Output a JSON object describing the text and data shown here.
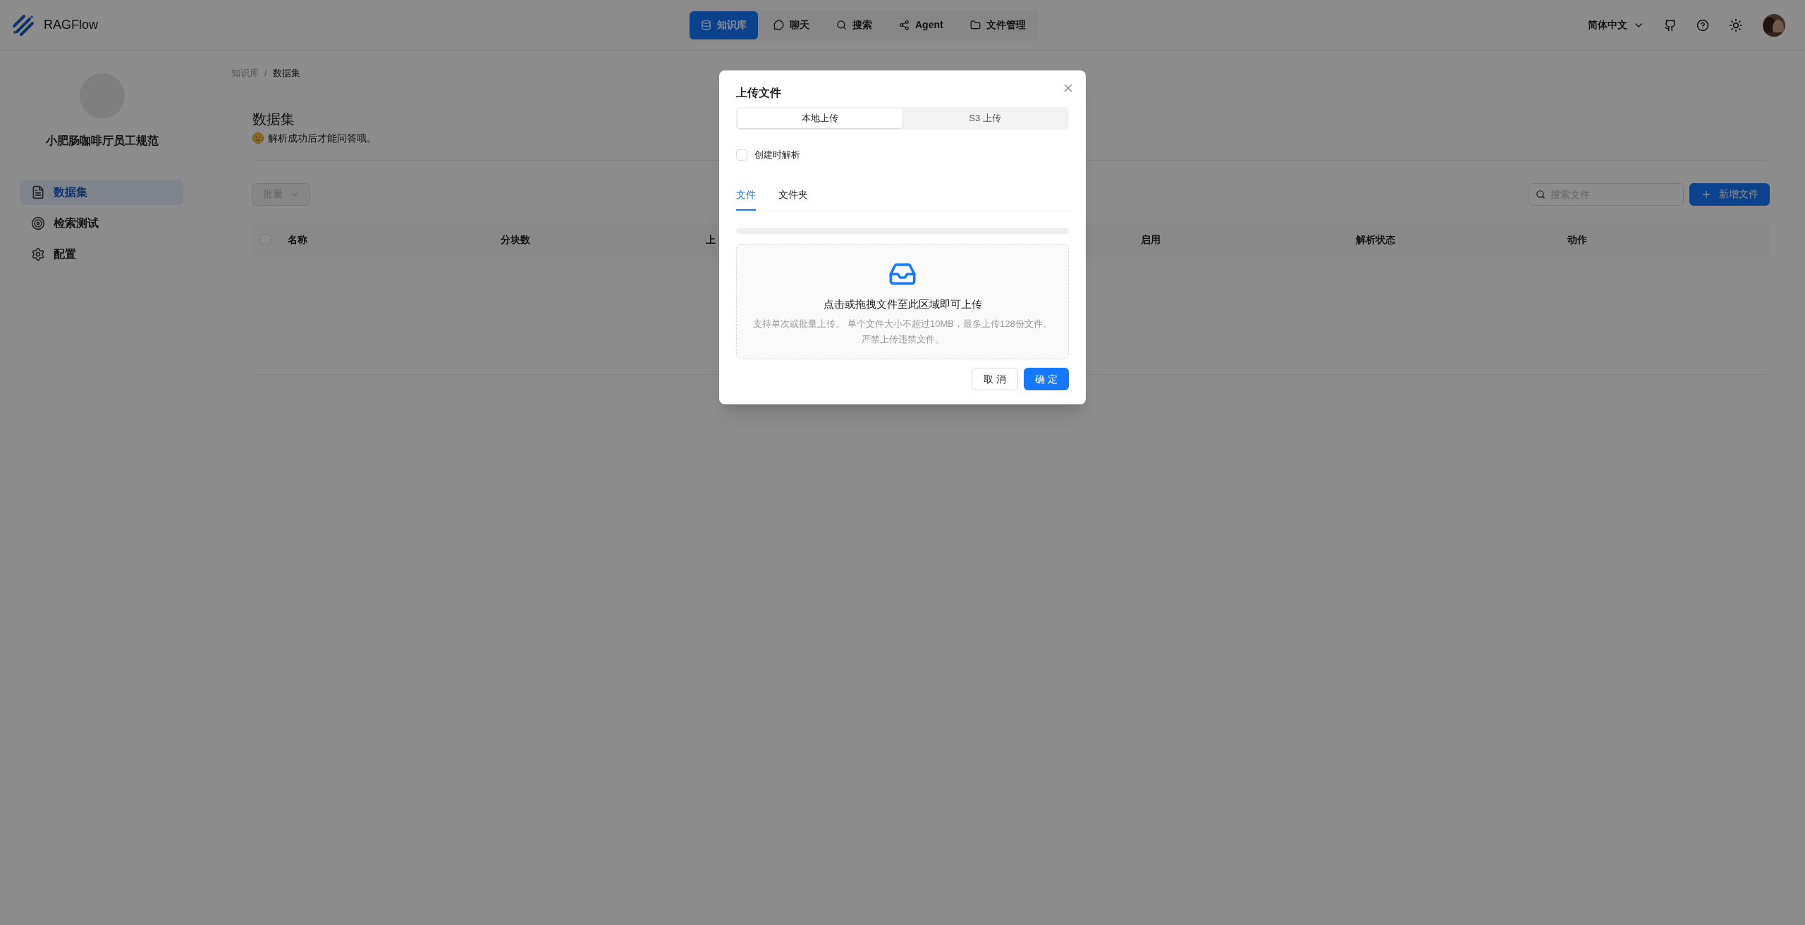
{
  "header": {
    "brand": "RAGFlow",
    "nav": [
      {
        "label": "知识库",
        "selected": true
      },
      {
        "label": "聊天",
        "selected": false
      },
      {
        "label": "搜索",
        "selected": false
      },
      {
        "label": "Agent",
        "selected": false
      },
      {
        "label": "文件管理",
        "selected": false
      }
    ],
    "language": "简体中文"
  },
  "sidebar": {
    "dataset_name": "小肥肠咖啡厅员工规范",
    "items": [
      {
        "label": "数据集",
        "selected": true
      },
      {
        "label": "检索测试",
        "selected": false
      },
      {
        "label": "配置",
        "selected": false
      }
    ]
  },
  "breadcrumb": {
    "separator": "/",
    "items": [
      {
        "label": "知识库",
        "current": false
      },
      {
        "label": "数据集",
        "current": true
      }
    ]
  },
  "page": {
    "title": "数据集",
    "subtitle": "解析成功后才能问答哦。"
  },
  "toolbar": {
    "batch": {
      "label": "批量",
      "disabled": true
    },
    "search": {
      "placeholder": "搜索文件"
    },
    "add_button": "新增文件"
  },
  "table": {
    "select_all": {
      "checked": false
    },
    "columns": [
      "名称",
      "分块数",
      "上",
      "启用",
      "解析状态",
      "动作"
    ]
  },
  "dialog": {
    "title": "上传文件",
    "source_tabs": [
      {
        "label": "本地上传",
        "selected": true
      },
      {
        "label": "S3 上传",
        "selected": false
      }
    ],
    "parse_on_create": {
      "label": "创建时解析",
      "checked": false
    },
    "tabs": [
      {
        "label": "文件",
        "selected": true
      },
      {
        "label": "文件夹",
        "selected": false
      }
    ],
    "dropzone": {
      "title": "点击或拖拽文件至此区域即可上传",
      "hint": "支持单次或批量上传。 单个文件大小不超过10MB，最多上传128份文件。严禁上传违禁文件。"
    },
    "buttons": [
      {
        "label": "取 消",
        "kind": "secondary"
      },
      {
        "label": "确 定",
        "kind": "primary"
      }
    ]
  }
}
